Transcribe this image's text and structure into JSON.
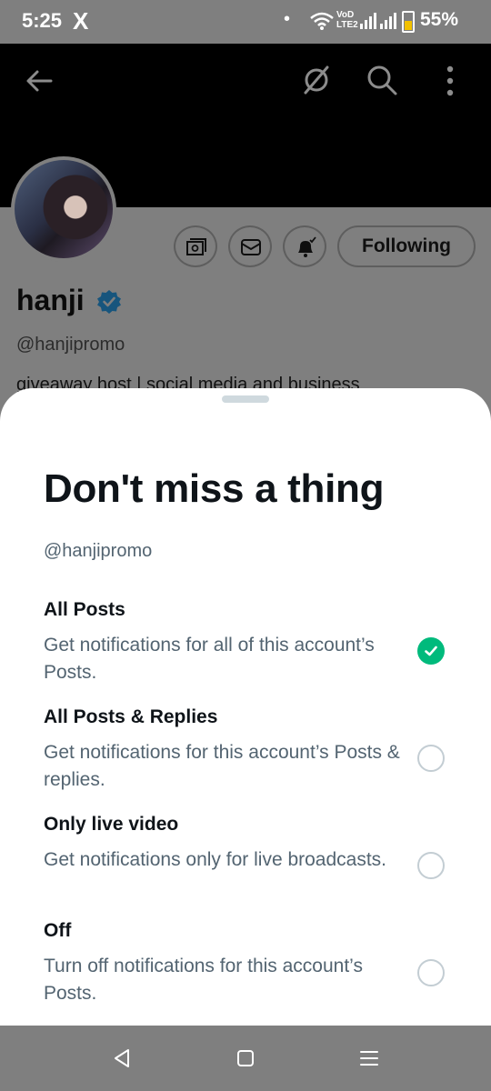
{
  "status_bar": {
    "time": "5:25",
    "app_glyph": "X",
    "dot": "•",
    "network_label_top": "VoD",
    "network_label_bottom": "LTE2",
    "battery_percent": "55%",
    "battery_level": 0.55
  },
  "header": {
    "back_icon": "back-arrow-icon",
    "hide_icon": "hide-icon",
    "search_icon": "search-icon",
    "more_icon": "more-vertical-icon"
  },
  "profile": {
    "name": "hanji",
    "handle": "@hanjipromo",
    "bio_visible": "giveaway host | social media and business",
    "following_label": "Following",
    "action_icons": [
      "wallet-icon",
      "mail-icon",
      "bell-check-icon"
    ]
  },
  "sheet": {
    "title": "Don't miss a thing",
    "handle": "@hanjipromo",
    "options": [
      {
        "title": "All Posts",
        "desc": "Get notifications for all of this account’s Posts.",
        "selected": true
      },
      {
        "title": "All Posts & Replies",
        "desc": "Get notifications for this account’s Posts & replies.",
        "selected": false
      },
      {
        "title": "Only live video",
        "desc": "Get notifications only for live broadcasts.",
        "selected": false
      },
      {
        "title": "Off",
        "desc": "Turn off notifications for this account’s Posts.",
        "selected": false
      }
    ]
  },
  "colors": {
    "selected": "#00ba7c",
    "text_primary": "#0f1419",
    "text_secondary": "#536471",
    "verified": "#1d9bf0"
  }
}
